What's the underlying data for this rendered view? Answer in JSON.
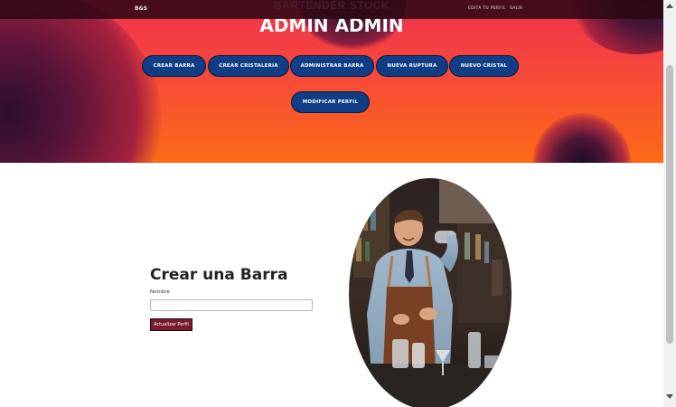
{
  "navbar": {
    "brand_short": "B&S",
    "brand_long": "BARTENDER STOCK",
    "links": [
      "EDITA TU PERFIL",
      "SALIR"
    ]
  },
  "hero": {
    "title": "ADMIN ADMIN",
    "buttons": [
      "CREAR BARRA",
      "CREAR CRISTALERIA",
      "ADMINISTRAR BARRA",
      "NUEVA RUPTURA",
      "NUEVO CRISTAL",
      "MODIFICAR PERFIL"
    ]
  },
  "form": {
    "title": "Crear una Barra",
    "name_label": "Nombre",
    "name_value": "",
    "submit_label": "Actualizar Perfil"
  },
  "colors": {
    "hero_top": "#f0304e",
    "hero_bottom": "#fc6a16",
    "button_blue": "#0f3e86",
    "submit_maroon": "#7a1a2f"
  }
}
